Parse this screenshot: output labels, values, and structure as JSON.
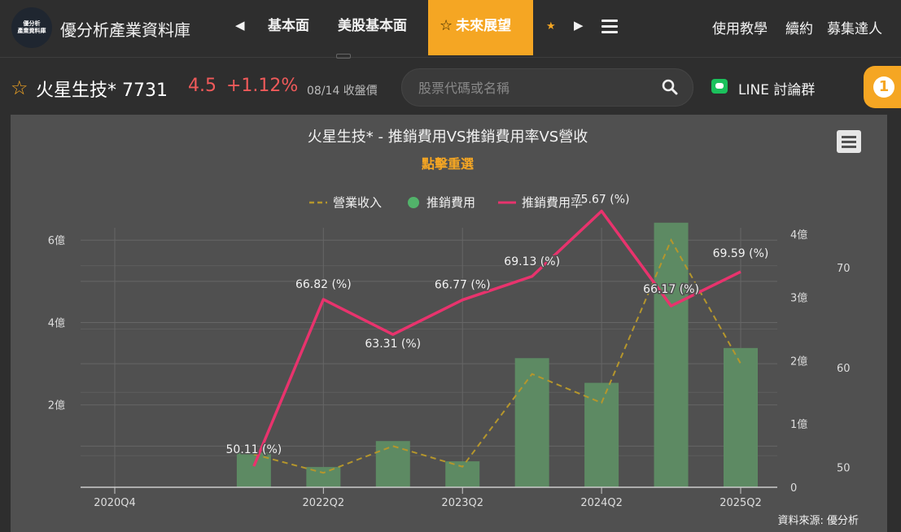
{
  "header": {
    "logo_lines": [
      "優分析",
      "產業資料庫"
    ],
    "site_title": "優分析產業資料庫",
    "nav_tabs": [
      {
        "label": "基本面"
      },
      {
        "label": "美股基本面"
      },
      {
        "label": "未來展望",
        "active": true
      }
    ],
    "right_links": [
      "使用教學",
      "續約",
      "募集達人"
    ]
  },
  "stock": {
    "name": "火星生技* 7731",
    "price": "4.5",
    "change": "+1.12%",
    "date_note": "08/14 收盤價"
  },
  "search": {
    "placeholder": "股票代碼或名稱"
  },
  "line_group": {
    "label": "LINE 討論群"
  },
  "badge": {
    "count": "1"
  },
  "colors": {
    "accent": "#f5a623",
    "price_up": "#f05a5a",
    "bar": "#5d8a63",
    "rate_line": "#e8336d",
    "revenue_line": "#b5962c",
    "panel_bg": "#505050"
  },
  "chart_data": {
    "type": "bar",
    "title": "火星生技* - 推銷費用VS推銷費用率VS營收",
    "subtitle": "點擊重選",
    "legend_position": "top-center",
    "grid": true,
    "source_note": "資料來源: 優分析",
    "x_ticks": [
      "2020Q4",
      "2022Q2",
      "2023Q2",
      "2024Q2",
      "2025Q2"
    ],
    "left_axis": {
      "ticks": [
        "2億",
        "4億",
        "6億"
      ],
      "range_yi": [
        0,
        6.3
      ]
    },
    "right_axis_1": {
      "ticks": [
        "0",
        "1億",
        "2億",
        "3億",
        "4億"
      ],
      "range_yi": [
        0,
        4.1
      ]
    },
    "right_axis_2": {
      "ticks": [
        "50",
        "60",
        "70"
      ],
      "range": [
        48,
        74
      ]
    },
    "series": [
      {
        "name": "營業收入",
        "type": "line-dashed",
        "axis": "left",
        "x": [
          "2021Q4",
          "2022Q2",
          "2022Q4",
          "2023Q2",
          "2023Q4",
          "2024Q2",
          "2024Q4",
          "2025Q2"
        ],
        "values": [
          0.8,
          0.35,
          1.0,
          0.5,
          2.75,
          2.05,
          6.0,
          3.0
        ]
      },
      {
        "name": "推銷費用",
        "type": "bar",
        "axis": "right",
        "x": [
          "2021Q4",
          "2022Q2",
          "2022Q4",
          "2023Q2",
          "2023Q4",
          "2024Q2",
          "2024Q4",
          "2025Q2"
        ],
        "values": [
          0.55,
          0.32,
          0.73,
          0.41,
          2.04,
          1.65,
          4.18,
          2.2
        ]
      },
      {
        "name": "推銷費用率",
        "type": "line",
        "axis": "right2",
        "x": [
          "2021Q4",
          "2022Q2",
          "2022Q4",
          "2023Q2",
          "2023Q4",
          "2024Q2",
          "2024Q4",
          "2025Q2"
        ],
        "values": [
          50.11,
          66.82,
          63.31,
          66.77,
          69.13,
          75.67,
          66.17,
          69.59
        ],
        "labels": [
          "50.11 (%)",
          "66.82 (%)",
          "63.31 (%)",
          "66.77 (%)",
          "69.13 (%)",
          "75.67 (%)",
          "66.17 (%)",
          "69.59 (%)"
        ]
      }
    ]
  }
}
